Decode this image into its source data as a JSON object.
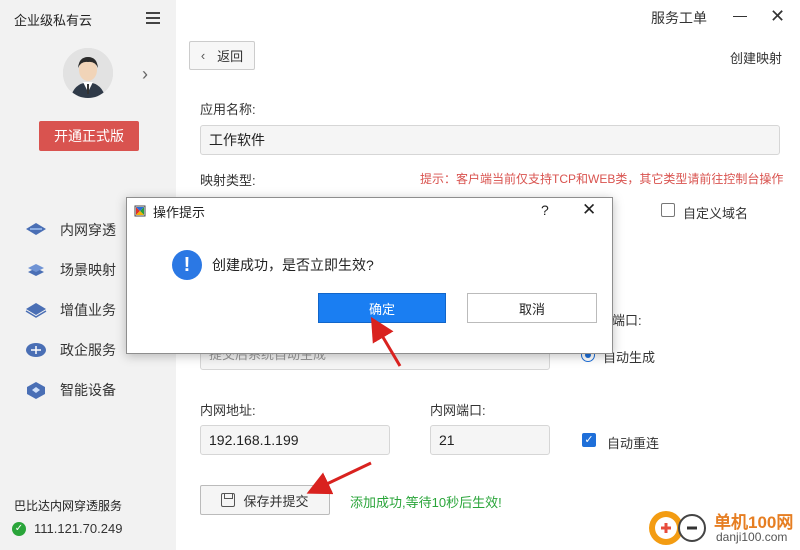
{
  "sidebar": {
    "app_title": "企业级私有云",
    "upgrade_label": "开通正式版",
    "items": [
      {
        "label": "内网穿透",
        "icon": "network-tunnel-icon"
      },
      {
        "label": "场景映射",
        "icon": "scene-mapping-icon"
      },
      {
        "label": "增值业务",
        "icon": "value-added-icon"
      },
      {
        "label": "政企服务",
        "icon": "enterprise-service-icon"
      },
      {
        "label": "智能设备",
        "icon": "smart-device-icon"
      }
    ],
    "server_label": "巴比达内网穿透服务",
    "server_ip": "111.121.70.249"
  },
  "header": {
    "service_ticket": "服务工单",
    "back_label": "返回",
    "page_title": "创建映射"
  },
  "form": {
    "app_name_label": "应用名称:",
    "app_name_value": "工作软件",
    "mapping_type_label": "映射类型:",
    "hint": "提示：客户端当前仅支持TCP和WEB类，其它类型请前往控制台操作",
    "custom_domain_label": "自定义域名",
    "port_label_partial": "端口:",
    "external_placeholder": "提交后系统自动生成",
    "auto_generate_label": "自动生成",
    "lan_address_label": "内网地址:",
    "lan_address_value": "192.168.1.199",
    "lan_port_label": "内网端口:",
    "lan_port_value": "21",
    "auto_reconnect_label": "自动重连",
    "save_label": "保存并提交",
    "success_msg": "添加成功,等待10秒后生效!"
  },
  "dialog": {
    "title": "操作提示",
    "help": "?",
    "message": "创建成功，是否立即生效?",
    "ok_label": "确定",
    "cancel_label": "取消"
  },
  "watermark": {
    "text": "单机100网",
    "url": "danji100.com"
  },
  "colors": {
    "accent_blue": "#1a7ef2",
    "upgrade_red": "#d9534f",
    "hint_red": "#d9534f",
    "success_green": "#2aa53a",
    "annotation_arrow": "#d9221f"
  }
}
